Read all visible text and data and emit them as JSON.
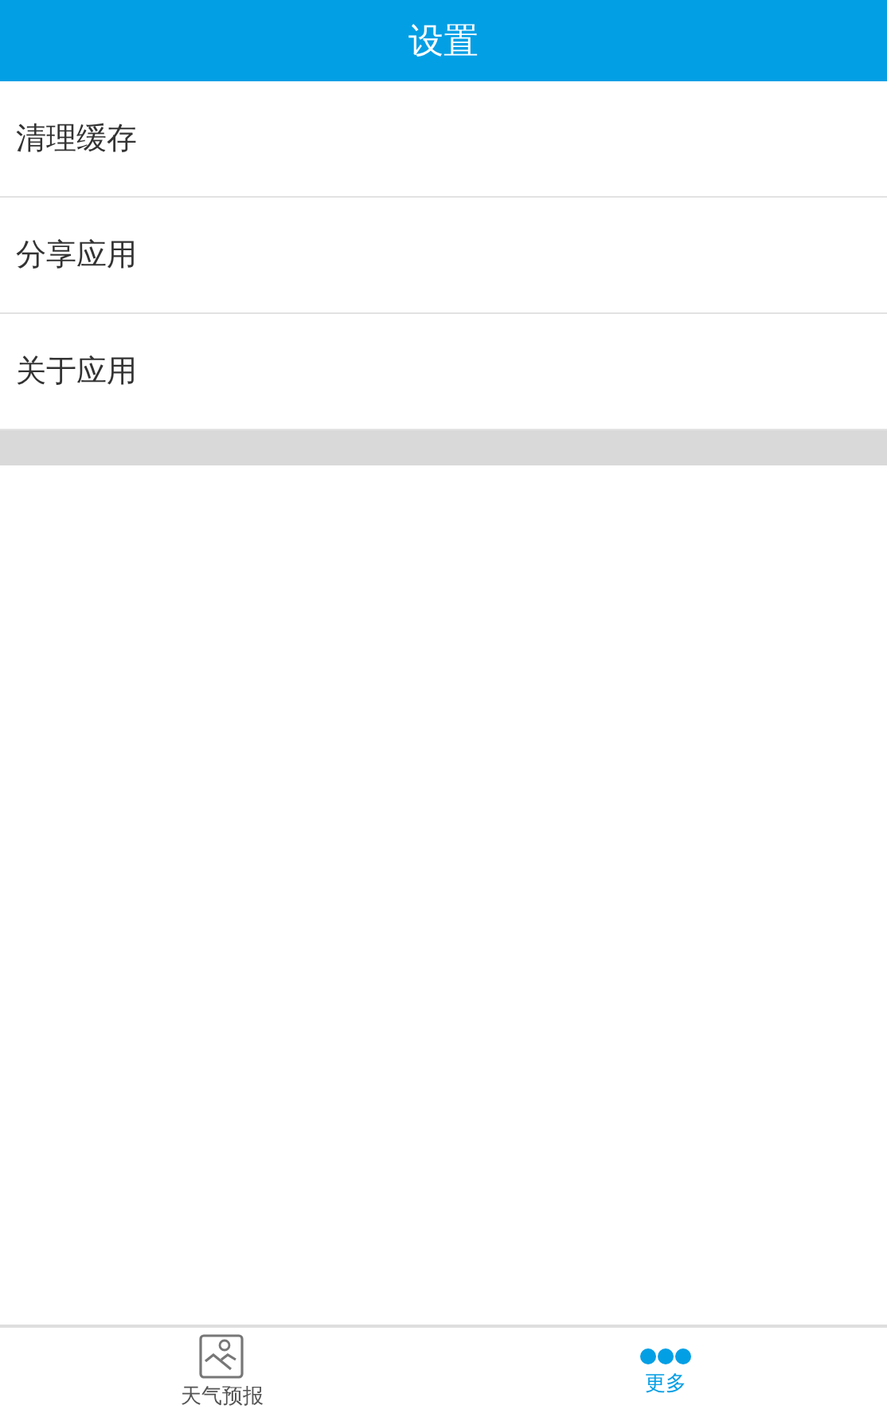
{
  "header": {
    "title": "设置"
  },
  "items": [
    {
      "label": "清理缓存"
    },
    {
      "label": "分享应用"
    },
    {
      "label": "关于应用"
    }
  ],
  "tabs": [
    {
      "label": "天气预报",
      "kind": "image",
      "selected": false
    },
    {
      "label": "更多",
      "kind": "more",
      "selected": true
    }
  ]
}
